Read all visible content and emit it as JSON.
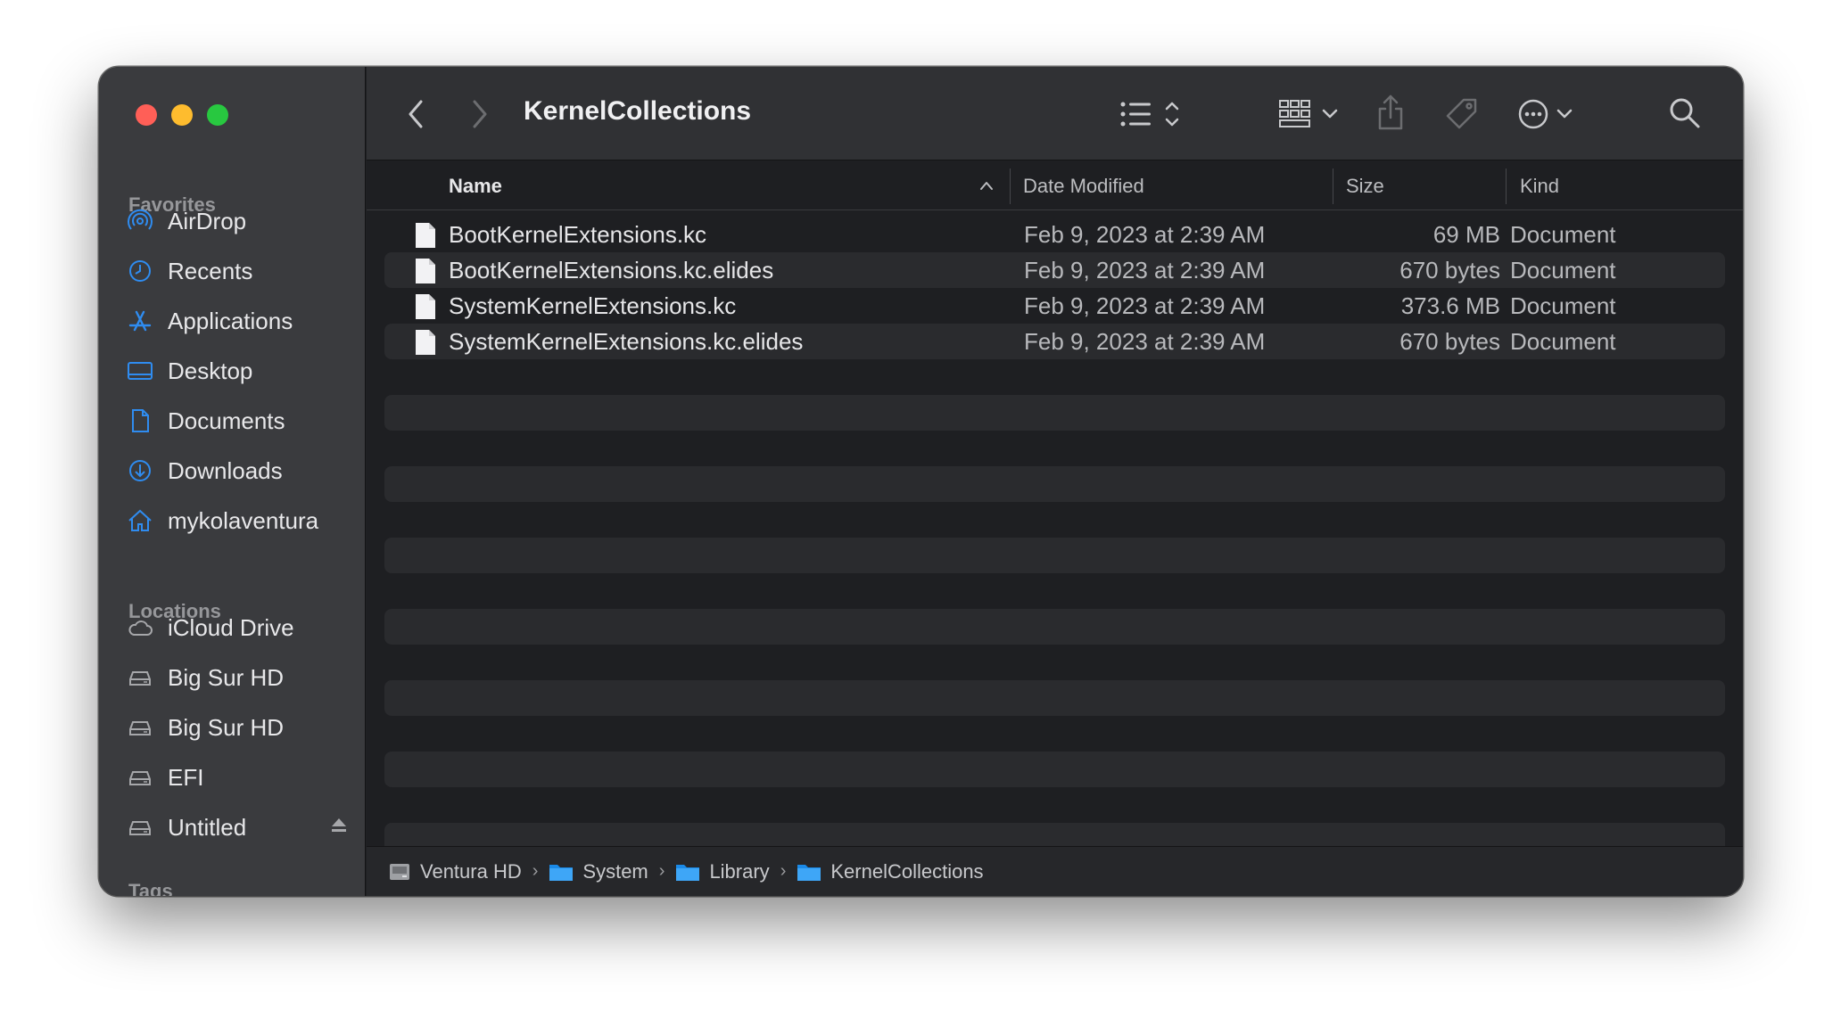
{
  "window": {
    "title": "KernelCollections"
  },
  "sidebar": {
    "favorites_label": "Favorites",
    "favorites": [
      {
        "label": "AirDrop",
        "icon": "airdrop-icon"
      },
      {
        "label": "Recents",
        "icon": "clock-icon"
      },
      {
        "label": "Applications",
        "icon": "applications-icon"
      },
      {
        "label": "Desktop",
        "icon": "desktop-icon"
      },
      {
        "label": "Documents",
        "icon": "document-icon"
      },
      {
        "label": "Downloads",
        "icon": "download-icon"
      },
      {
        "label": "mykolaventura",
        "icon": "home-icon"
      }
    ],
    "locations_label": "Locations",
    "locations": [
      {
        "label": "iCloud Drive",
        "icon": "cloud-icon"
      },
      {
        "label": "Big Sur HD",
        "icon": "disk-icon"
      },
      {
        "label": "Big Sur HD",
        "icon": "disk-icon"
      },
      {
        "label": "EFI",
        "icon": "disk-icon"
      },
      {
        "label": "Untitled",
        "icon": "disk-icon",
        "ejectable": true
      }
    ],
    "tags_label": "Tags"
  },
  "columns": {
    "name": "Name",
    "date": "Date Modified",
    "size": "Size",
    "kind": "Kind"
  },
  "files": [
    {
      "name": "BootKernelExtensions.kc",
      "date": "Feb 9, 2023 at 2:39 AM",
      "size": "69 MB",
      "kind": "Document"
    },
    {
      "name": "BootKernelExtensions.kc.elides",
      "date": "Feb 9, 2023 at 2:39 AM",
      "size": "670 bytes",
      "kind": "Document"
    },
    {
      "name": "SystemKernelExtensions.kc",
      "date": "Feb 9, 2023 at 2:39 AM",
      "size": "373.6 MB",
      "kind": "Document"
    },
    {
      "name": "SystemKernelExtensions.kc.elides",
      "date": "Feb 9, 2023 at 2:39 AM",
      "size": "670 bytes",
      "kind": "Document"
    }
  ],
  "pathbar": [
    "Ventura HD",
    "System",
    "Library",
    "KernelCollections"
  ],
  "colors": {
    "accent": "#2f8cf0",
    "sidebar_bg": "#3a3b3e",
    "content_bg": "#1e1f22",
    "stripe": "#2a2b2e"
  }
}
